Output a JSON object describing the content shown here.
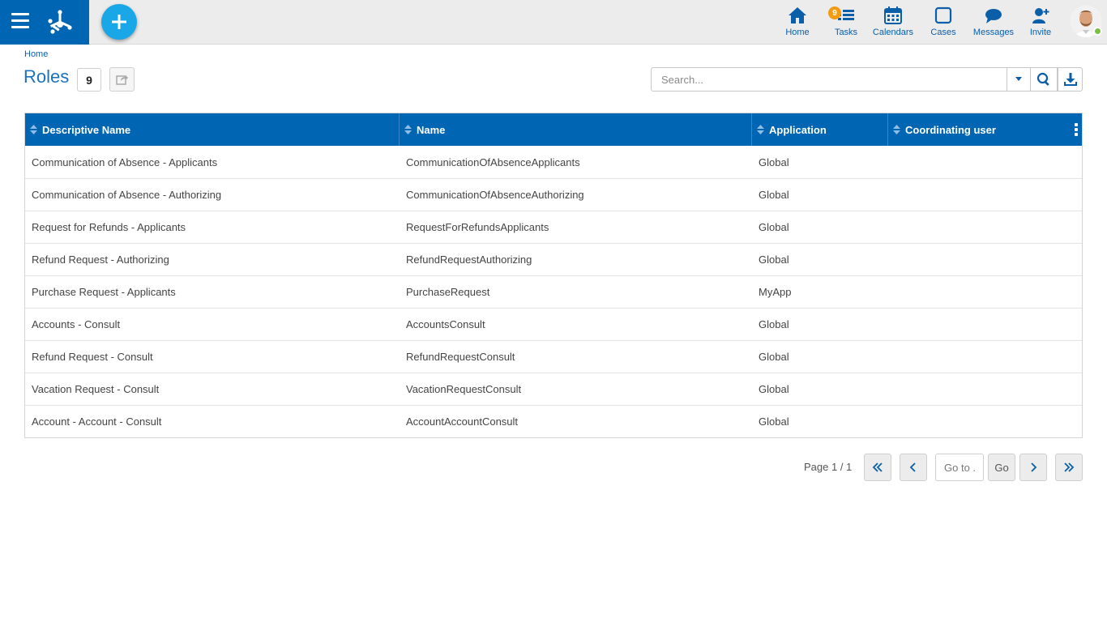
{
  "topbar": {
    "nav": [
      {
        "id": "home",
        "label": "Home",
        "icon": "home-icon"
      },
      {
        "id": "tasks",
        "label": "Tasks",
        "icon": "tasks-icon",
        "badge": "9"
      },
      {
        "id": "calendars",
        "label": "Calendars",
        "icon": "calendar-icon"
      },
      {
        "id": "cases",
        "label": "Cases",
        "icon": "cases-icon"
      },
      {
        "id": "messages",
        "label": "Messages",
        "icon": "messages-icon"
      },
      {
        "id": "invite",
        "label": "Invite",
        "icon": "invite-user-icon"
      }
    ],
    "accent_color": "#0066b3",
    "add_button_color": "#1aa7e8"
  },
  "header": {
    "breadcrumb": "Home",
    "title": "Roles",
    "count": "9",
    "search_placeholder": "Search..."
  },
  "table": {
    "columns": [
      "Descriptive Name",
      "Name",
      "Application",
      "Coordinating user"
    ],
    "rows": [
      [
        "Communication of Absence - Applicants",
        "CommunicationOfAbsenceApplicants",
        "Global",
        ""
      ],
      [
        "Communication of Absence - Authorizing",
        "CommunicationOfAbsenceAuthorizing",
        "Global",
        ""
      ],
      [
        "Request for Refunds - Applicants",
        "RequestForRefundsApplicants",
        "Global",
        ""
      ],
      [
        "Refund Request - Authorizing",
        "RefundRequestAuthorizing",
        "Global",
        ""
      ],
      [
        "Purchase Request - Applicants",
        "PurchaseRequest",
        "MyApp",
        ""
      ],
      [
        "Accounts - Consult",
        "AccountsConsult",
        "Global",
        ""
      ],
      [
        "Refund Request - Consult",
        "RefundRequestConsult",
        "Global",
        ""
      ],
      [
        "Vacation Request - Consult",
        "VacationRequestConsult",
        "Global",
        ""
      ],
      [
        "Account - Account - Consult",
        "AccountAccountConsult",
        "Global",
        ""
      ]
    ]
  },
  "pagination": {
    "page_info": "Page 1 / 1",
    "goto_placeholder": "Go to ...",
    "go_label": "Go"
  }
}
